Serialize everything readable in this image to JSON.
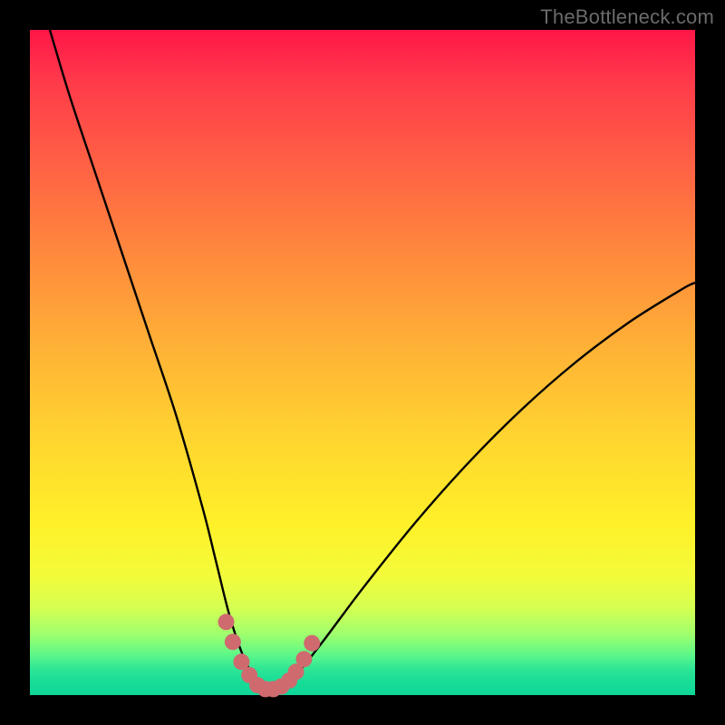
{
  "watermark": "TheBottleneck.com",
  "colors": {
    "frame": "#000000",
    "gradient_top": "#ff1648",
    "gradient_mid": "#ffd62f",
    "gradient_bottom": "#0fd698",
    "curve": "#000000",
    "marker": "#cf6a6f"
  },
  "chart_data": {
    "type": "line",
    "title": "",
    "xlabel": "",
    "ylabel": "",
    "xlim": [
      0,
      100
    ],
    "ylim": [
      0,
      100
    ],
    "series": [
      {
        "name": "bottleneck-curve",
        "x": [
          3,
          6,
          10,
          14,
          18,
          22,
          26,
          28,
          30,
          32,
          34,
          35,
          36,
          38,
          40,
          44,
          50,
          58,
          66,
          74,
          82,
          90,
          98,
          100
        ],
        "y": [
          100,
          90,
          78,
          66,
          54,
          42,
          28,
          20,
          12,
          6,
          2,
          0.8,
          0.8,
          1.2,
          3,
          8,
          16,
          26,
          35,
          43,
          50,
          56,
          61,
          62
        ]
      }
    ],
    "markers": {
      "name": "highlight-dots",
      "x": [
        29.5,
        30.5,
        31.8,
        33.0,
        34.2,
        35.4,
        36.6,
        37.8,
        39.0,
        40.0,
        41.2,
        42.4
      ],
      "y": [
        11.0,
        8.0,
        5.0,
        3.0,
        1.5,
        0.9,
        0.9,
        1.3,
        2.2,
        3.5,
        5.4,
        7.8
      ]
    },
    "annotations": []
  }
}
